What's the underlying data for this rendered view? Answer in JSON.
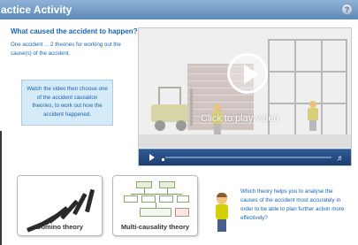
{
  "header": {
    "title": "actice Activity",
    "help_label": "?"
  },
  "question": {
    "heading": "What caused the accident to happen?",
    "intro": "One accident ... 2 theories for working out the cause(s) of the accident.",
    "instruction": "Watch the video then choose one of the accident causation theories, to work out how the accident happened."
  },
  "video": {
    "caption": "Click to play video",
    "volume_icon": "speaker-icon"
  },
  "theories": [
    {
      "label": "Domino theory"
    },
    {
      "label": "Multi-causality theory"
    }
  ],
  "prompt": {
    "text": "Which theory helps you to analyse the causes of the accident most accurately in order to be able to plan further action more effectively?"
  },
  "colors": {
    "accent_blue": "#1a63b0",
    "header_blue": "#5d8ab8",
    "instruction_bg": "#d5ebf8",
    "video_bar": "#1d3e6e"
  }
}
